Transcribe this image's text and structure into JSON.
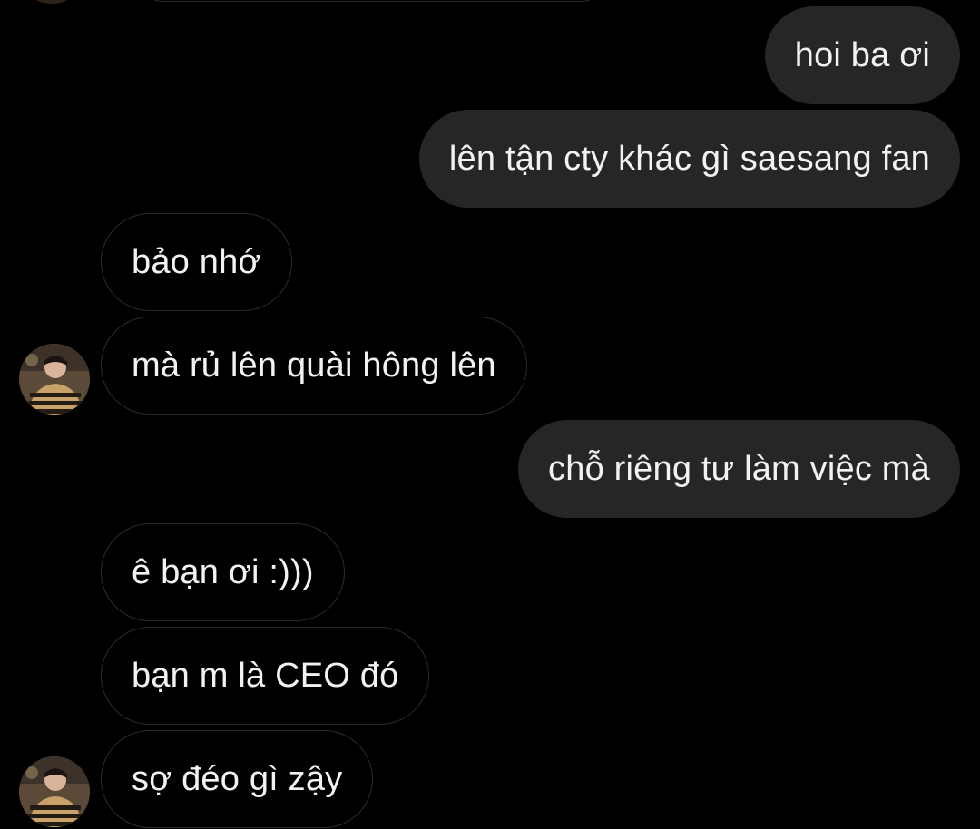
{
  "messages": [
    {
      "id": "m1",
      "direction": "outgoing",
      "text": "hoi ba ơi"
    },
    {
      "id": "m2",
      "direction": "outgoing",
      "text": "lên tận cty khác gì saesang fan"
    },
    {
      "id": "m3",
      "direction": "incoming",
      "text": "bảo nhớ"
    },
    {
      "id": "m4",
      "direction": "incoming",
      "text": "mà rủ lên quài hông lên"
    },
    {
      "id": "m5",
      "direction": "outgoing",
      "text": "chỗ riêng tư làm việc mà"
    },
    {
      "id": "m6",
      "direction": "incoming",
      "text": "ê bạn ơi :)))"
    },
    {
      "id": "m7",
      "direction": "incoming",
      "text": "bạn m là CEO đó"
    },
    {
      "id": "m8",
      "direction": "incoming",
      "text": "sợ đéo gì zậy"
    }
  ],
  "theme": {
    "background": "#000000",
    "outgoing_bubble": "#262626",
    "incoming_border": "#2c2c2c",
    "text": "#f2f2f2"
  },
  "avatar_icon": "contact-avatar-photo"
}
